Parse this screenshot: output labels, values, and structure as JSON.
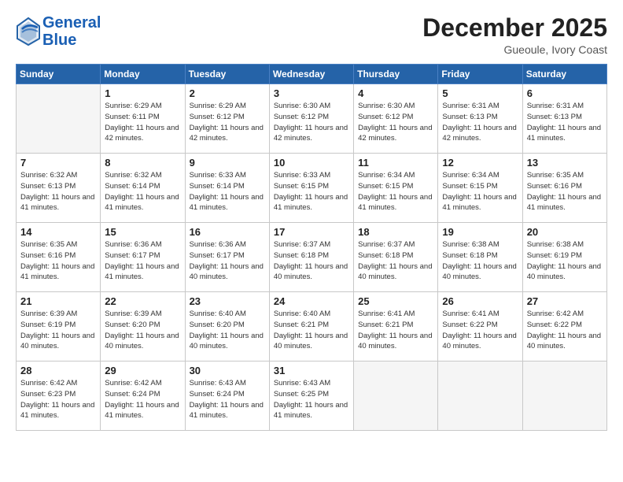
{
  "header": {
    "logo_line1": "General",
    "logo_line2": "Blue",
    "month": "December 2025",
    "location": "Gueoule, Ivory Coast"
  },
  "weekdays": [
    "Sunday",
    "Monday",
    "Tuesday",
    "Wednesday",
    "Thursday",
    "Friday",
    "Saturday"
  ],
  "weeks": [
    [
      {
        "num": "",
        "sunrise": "",
        "sunset": "",
        "daylight": ""
      },
      {
        "num": "1",
        "sunrise": "Sunrise: 6:29 AM",
        "sunset": "Sunset: 6:11 PM",
        "daylight": "Daylight: 11 hours and 42 minutes."
      },
      {
        "num": "2",
        "sunrise": "Sunrise: 6:29 AM",
        "sunset": "Sunset: 6:12 PM",
        "daylight": "Daylight: 11 hours and 42 minutes."
      },
      {
        "num": "3",
        "sunrise": "Sunrise: 6:30 AM",
        "sunset": "Sunset: 6:12 PM",
        "daylight": "Daylight: 11 hours and 42 minutes."
      },
      {
        "num": "4",
        "sunrise": "Sunrise: 6:30 AM",
        "sunset": "Sunset: 6:12 PM",
        "daylight": "Daylight: 11 hours and 42 minutes."
      },
      {
        "num": "5",
        "sunrise": "Sunrise: 6:31 AM",
        "sunset": "Sunset: 6:13 PM",
        "daylight": "Daylight: 11 hours and 42 minutes."
      },
      {
        "num": "6",
        "sunrise": "Sunrise: 6:31 AM",
        "sunset": "Sunset: 6:13 PM",
        "daylight": "Daylight: 11 hours and 41 minutes."
      }
    ],
    [
      {
        "num": "7",
        "sunrise": "Sunrise: 6:32 AM",
        "sunset": "Sunset: 6:13 PM",
        "daylight": "Daylight: 11 hours and 41 minutes."
      },
      {
        "num": "8",
        "sunrise": "Sunrise: 6:32 AM",
        "sunset": "Sunset: 6:14 PM",
        "daylight": "Daylight: 11 hours and 41 minutes."
      },
      {
        "num": "9",
        "sunrise": "Sunrise: 6:33 AM",
        "sunset": "Sunset: 6:14 PM",
        "daylight": "Daylight: 11 hours and 41 minutes."
      },
      {
        "num": "10",
        "sunrise": "Sunrise: 6:33 AM",
        "sunset": "Sunset: 6:15 PM",
        "daylight": "Daylight: 11 hours and 41 minutes."
      },
      {
        "num": "11",
        "sunrise": "Sunrise: 6:34 AM",
        "sunset": "Sunset: 6:15 PM",
        "daylight": "Daylight: 11 hours and 41 minutes."
      },
      {
        "num": "12",
        "sunrise": "Sunrise: 6:34 AM",
        "sunset": "Sunset: 6:15 PM",
        "daylight": "Daylight: 11 hours and 41 minutes."
      },
      {
        "num": "13",
        "sunrise": "Sunrise: 6:35 AM",
        "sunset": "Sunset: 6:16 PM",
        "daylight": "Daylight: 11 hours and 41 minutes."
      }
    ],
    [
      {
        "num": "14",
        "sunrise": "Sunrise: 6:35 AM",
        "sunset": "Sunset: 6:16 PM",
        "daylight": "Daylight: 11 hours and 41 minutes."
      },
      {
        "num": "15",
        "sunrise": "Sunrise: 6:36 AM",
        "sunset": "Sunset: 6:17 PM",
        "daylight": "Daylight: 11 hours and 41 minutes."
      },
      {
        "num": "16",
        "sunrise": "Sunrise: 6:36 AM",
        "sunset": "Sunset: 6:17 PM",
        "daylight": "Daylight: 11 hours and 40 minutes."
      },
      {
        "num": "17",
        "sunrise": "Sunrise: 6:37 AM",
        "sunset": "Sunset: 6:18 PM",
        "daylight": "Daylight: 11 hours and 40 minutes."
      },
      {
        "num": "18",
        "sunrise": "Sunrise: 6:37 AM",
        "sunset": "Sunset: 6:18 PM",
        "daylight": "Daylight: 11 hours and 40 minutes."
      },
      {
        "num": "19",
        "sunrise": "Sunrise: 6:38 AM",
        "sunset": "Sunset: 6:18 PM",
        "daylight": "Daylight: 11 hours and 40 minutes."
      },
      {
        "num": "20",
        "sunrise": "Sunrise: 6:38 AM",
        "sunset": "Sunset: 6:19 PM",
        "daylight": "Daylight: 11 hours and 40 minutes."
      }
    ],
    [
      {
        "num": "21",
        "sunrise": "Sunrise: 6:39 AM",
        "sunset": "Sunset: 6:19 PM",
        "daylight": "Daylight: 11 hours and 40 minutes."
      },
      {
        "num": "22",
        "sunrise": "Sunrise: 6:39 AM",
        "sunset": "Sunset: 6:20 PM",
        "daylight": "Daylight: 11 hours and 40 minutes."
      },
      {
        "num": "23",
        "sunrise": "Sunrise: 6:40 AM",
        "sunset": "Sunset: 6:20 PM",
        "daylight": "Daylight: 11 hours and 40 minutes."
      },
      {
        "num": "24",
        "sunrise": "Sunrise: 6:40 AM",
        "sunset": "Sunset: 6:21 PM",
        "daylight": "Daylight: 11 hours and 40 minutes."
      },
      {
        "num": "25",
        "sunrise": "Sunrise: 6:41 AM",
        "sunset": "Sunset: 6:21 PM",
        "daylight": "Daylight: 11 hours and 40 minutes."
      },
      {
        "num": "26",
        "sunrise": "Sunrise: 6:41 AM",
        "sunset": "Sunset: 6:22 PM",
        "daylight": "Daylight: 11 hours and 40 minutes."
      },
      {
        "num": "27",
        "sunrise": "Sunrise: 6:42 AM",
        "sunset": "Sunset: 6:22 PM",
        "daylight": "Daylight: 11 hours and 40 minutes."
      }
    ],
    [
      {
        "num": "28",
        "sunrise": "Sunrise: 6:42 AM",
        "sunset": "Sunset: 6:23 PM",
        "daylight": "Daylight: 11 hours and 41 minutes."
      },
      {
        "num": "29",
        "sunrise": "Sunrise: 6:42 AM",
        "sunset": "Sunset: 6:24 PM",
        "daylight": "Daylight: 11 hours and 41 minutes."
      },
      {
        "num": "30",
        "sunrise": "Sunrise: 6:43 AM",
        "sunset": "Sunset: 6:24 PM",
        "daylight": "Daylight: 11 hours and 41 minutes."
      },
      {
        "num": "31",
        "sunrise": "Sunrise: 6:43 AM",
        "sunset": "Sunset: 6:25 PM",
        "daylight": "Daylight: 11 hours and 41 minutes."
      },
      {
        "num": "",
        "sunrise": "",
        "sunset": "",
        "daylight": ""
      },
      {
        "num": "",
        "sunrise": "",
        "sunset": "",
        "daylight": ""
      },
      {
        "num": "",
        "sunrise": "",
        "sunset": "",
        "daylight": ""
      }
    ]
  ]
}
